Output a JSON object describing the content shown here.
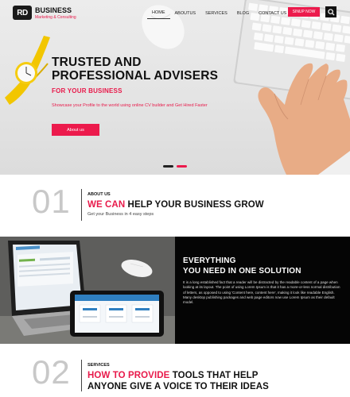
{
  "header": {
    "logo_mark": "RD",
    "logo_title": "BUSINESS",
    "logo_subtitle": "Marketing & Consulting",
    "nav": [
      {
        "label": "HOME"
      },
      {
        "label": "ABOUTUS"
      },
      {
        "label": "SERVICES"
      },
      {
        "label": "BLOG"
      },
      {
        "label": "CONTACT US"
      }
    ],
    "signup_label": "SINUP NOW",
    "search_icon": "search-icon"
  },
  "hero": {
    "title_line1": "TRUSTED AND",
    "title_line2": "PROFESSIONAL ADVISERS",
    "subtitle": "FOR YOUR BUSINESS",
    "description": "Showcase your Profile to the world using online CV builder and Get Hired Faster",
    "cta_label": "About us",
    "slides": 2,
    "active_slide": 2
  },
  "about": {
    "number": "01",
    "eyebrow": "ABOUT US",
    "title_accent": "WE CAN",
    "title_rest": " HELP YOUR BUSINESS GROW",
    "subtitle": "Get your Business in 4 easy steps"
  },
  "solution": {
    "title_line1": "EVERYTHING",
    "title_line2": "YOU NEED IN ONE SOLUTION",
    "body": "It is a long established fact that a reader will be distracted by the readable content of a page when looking at its layout. The point of using Lorem Ipsum is that it has a more-or-less normal distribution of letters, as opposed to using 'Content here, content here', making it look like readable English. Many desktop publishing packages and web page editors now use Lorem Ipsum as their default model."
  },
  "services": {
    "number": "02",
    "eyebrow": "SERVICES",
    "title_accent": "HOW TO PROVIDE",
    "title_rest_line1": " TOOLS THAT HELP",
    "title_line2": "ANYONE GIVE A VOICE TO THEIR IDEAS"
  },
  "colors": {
    "accent": "#ec1a4c",
    "dark": "#050505",
    "number_gray": "#c8c8c8"
  }
}
